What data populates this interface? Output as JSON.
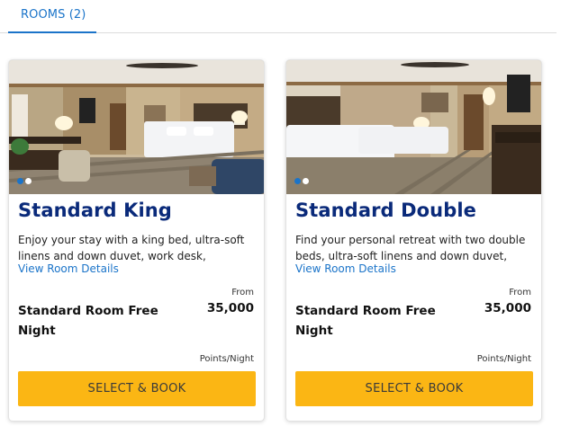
{
  "tabs": [
    {
      "label": "ROOMS (2)"
    }
  ],
  "rooms": [
    {
      "title": "Standard King",
      "description": "Enjoy your stay with a king bed, ultra-soft linens and down duvet, work desk, windows…",
      "view_details": "View Room Details",
      "from_label": "From",
      "rate_name": "Standard Room Free Night",
      "points": "35,000",
      "points_unit": "Points/Night",
      "book_label": "SELECT & BOOK",
      "photo_count": 2,
      "active_photo": 1
    },
    {
      "title": "Standard Double",
      "description": "Find your personal retreat with two double beds, ultra-soft linens and down duvet, work…",
      "view_details": "View Room Details",
      "from_label": "From",
      "rate_name": "Standard Room Free Night",
      "points": "35,000",
      "points_unit": "Points/Night",
      "book_label": "SELECT & BOOK",
      "photo_count": 2,
      "active_photo": 1
    }
  ],
  "colors": {
    "accent": "#1b74c9",
    "title": "#0a2a7a",
    "button": "#fbb614"
  }
}
